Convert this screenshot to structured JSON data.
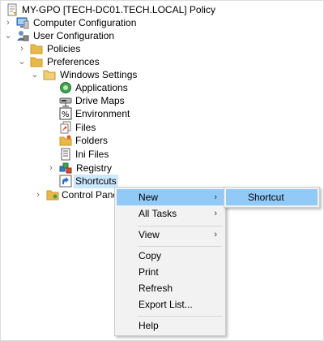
{
  "tree": {
    "root": {
      "label": "MY-GPO [TECH-DC01.TECH.LOCAL] Policy",
      "icon": "policy-doc-icon"
    },
    "computer_config": {
      "label": "Computer Configuration",
      "icon": "computer-icon",
      "chevron": "›"
    },
    "user_config": {
      "label": "User Configuration",
      "icon": "users-icon",
      "chevron": "⌄"
    },
    "policies": {
      "label": "Policies",
      "icon": "folder-icon",
      "chevron": "›"
    },
    "preferences": {
      "label": "Preferences",
      "icon": "folder-icon",
      "chevron": "⌄"
    },
    "windows_settings": {
      "label": "Windows Settings",
      "icon": "folder-icon",
      "chevron": "⌄"
    },
    "applications": {
      "label": "Applications",
      "icon": "applications-icon"
    },
    "drive_maps": {
      "label": "Drive Maps",
      "icon": "drive-maps-icon"
    },
    "environment": {
      "label": "Environment",
      "icon": "environment-icon"
    },
    "files": {
      "label": "Files",
      "icon": "files-icon"
    },
    "folders": {
      "label": "Folders",
      "icon": "folders-icon"
    },
    "ini_files": {
      "label": "Ini Files",
      "icon": "ini-files-icon"
    },
    "registry": {
      "label": "Registry",
      "icon": "registry-icon",
      "chevron": "›"
    },
    "shortcuts": {
      "label": "Shortcuts",
      "icon": "shortcut-icon"
    },
    "control_panel": {
      "label": "Control Panel",
      "icon": "control-panel-icon",
      "chevron": "›"
    }
  },
  "context_menu": {
    "items": [
      {
        "label": "New",
        "has_submenu": true,
        "highlighted": true
      },
      {
        "label": "All Tasks",
        "has_submenu": true
      },
      {
        "label": "View",
        "has_submenu": true
      },
      {
        "label": "Copy"
      },
      {
        "label": "Print"
      },
      {
        "label": "Refresh"
      },
      {
        "label": "Export List..."
      },
      {
        "label": "Help"
      }
    ],
    "submenu_arrow": "›"
  },
  "submenu": {
    "items": [
      {
        "label": "Shortcut",
        "highlighted": true
      }
    ]
  },
  "colors": {
    "menu_background": "#f2f2f2",
    "menu_highlight": "#91c9f7",
    "folder_yellow": "#e8b947",
    "selection": "#cce8ff"
  }
}
